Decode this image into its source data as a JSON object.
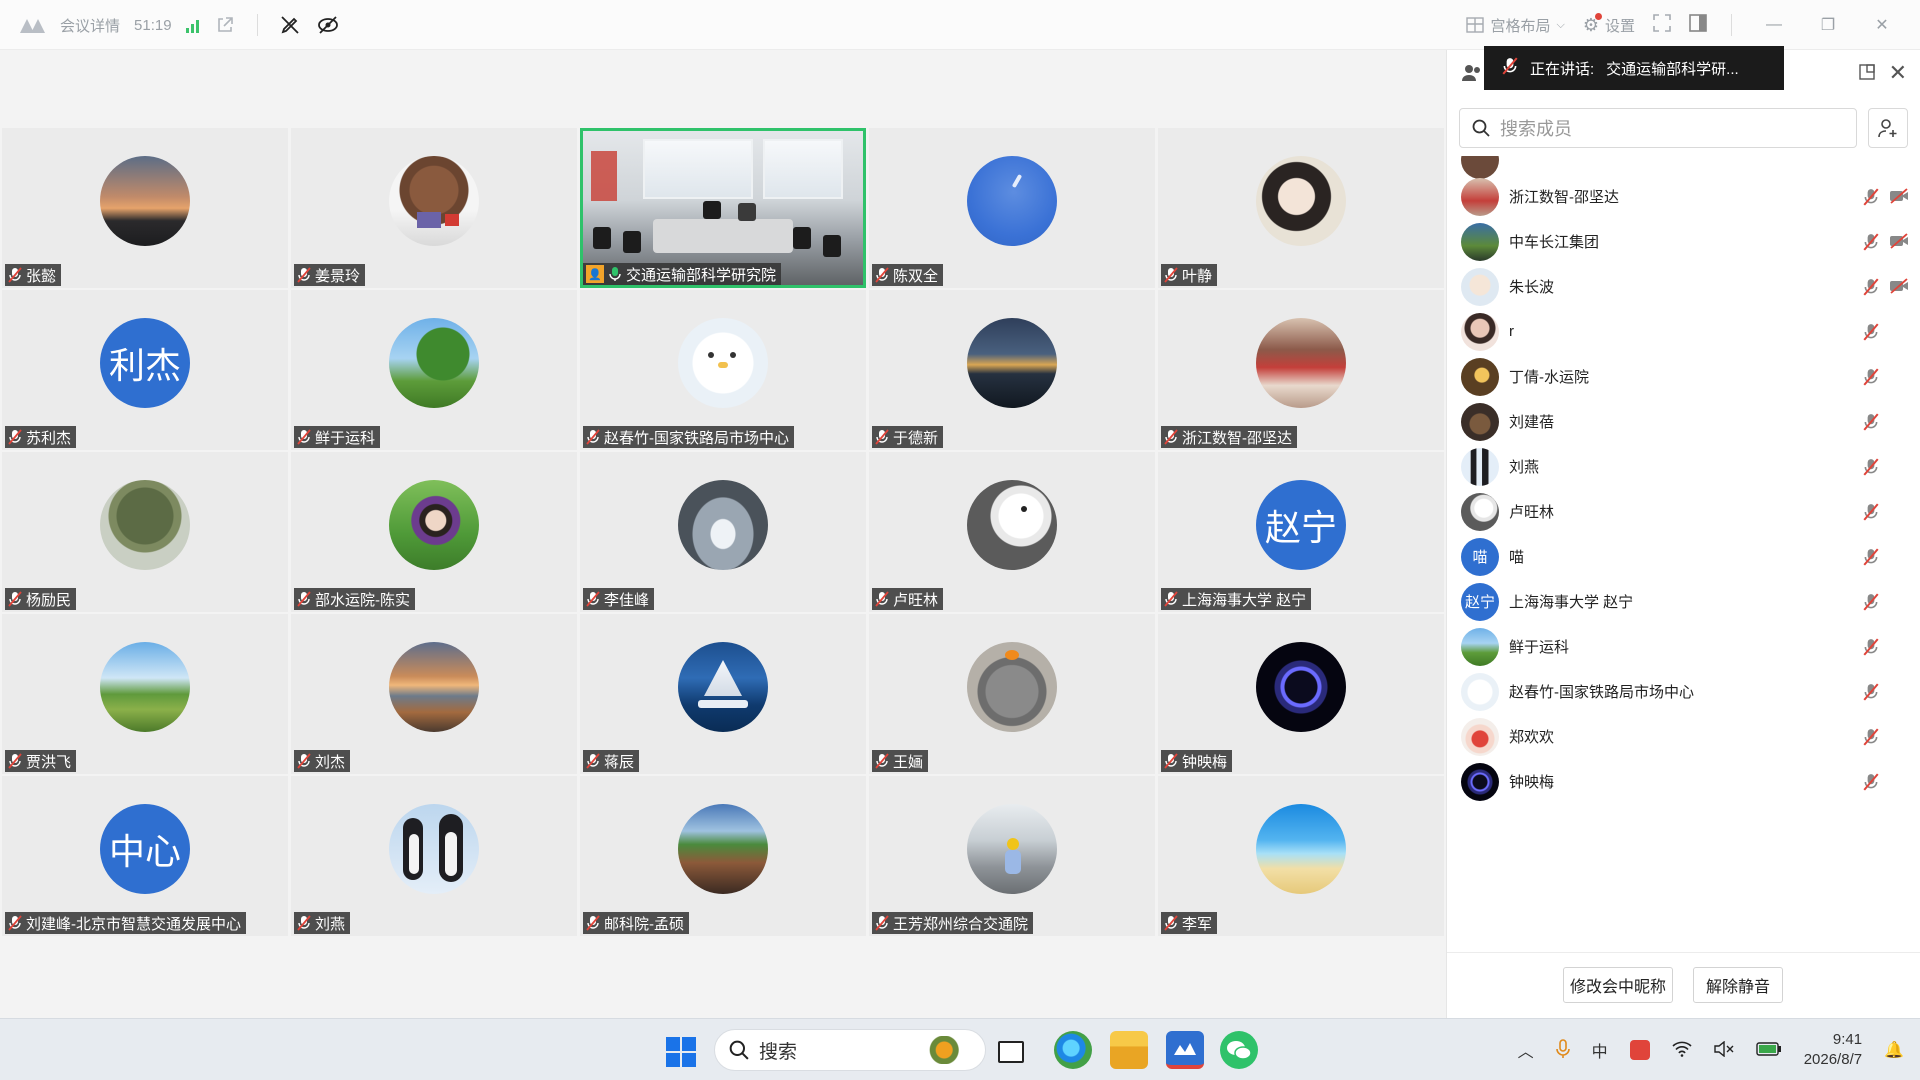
{
  "titlebar": {
    "meeting_details": "会议详情",
    "timer": "51:19",
    "layout_label": "宫格布局",
    "settings_label": "设置"
  },
  "tiles": [
    {
      "name": "张懿",
      "avatar": "sunset-photo"
    },
    {
      "name": "姜景玲",
      "avatar": "bear-photo"
    },
    {
      "name": "交通运输部科学研究院",
      "avatar": "meeting-room-video",
      "active": true
    },
    {
      "name": "陈双全",
      "avatar": "blue-sky-moon"
    },
    {
      "name": "叶静",
      "avatar": "woman-portrait"
    },
    {
      "name": "苏利杰",
      "avatar_text": "利杰"
    },
    {
      "name": "鲜于运科",
      "avatar": "tree-photo"
    },
    {
      "name": "赵春竹-国家铁路局市场中心",
      "avatar": "cartoon-bird"
    },
    {
      "name": "于德新",
      "avatar": "city-night"
    },
    {
      "name": "浙江数智-邵坚达",
      "avatar": "old-poster"
    },
    {
      "name": "杨励民",
      "avatar": "big-tree"
    },
    {
      "name": "部水运院-陈实",
      "avatar": "woman-garden"
    },
    {
      "name": "李佳峰",
      "avatar": "silver-abstract"
    },
    {
      "name": "卢旺林",
      "avatar": "bear-book"
    },
    {
      "name": "上海海事大学 赵宁",
      "avatar_text": "赵宁"
    },
    {
      "name": "贾洪飞",
      "avatar": "green-hills"
    },
    {
      "name": "刘杰",
      "avatar": "seaside-sunset"
    },
    {
      "name": "蒋辰",
      "avatar": "sailing-ship"
    },
    {
      "name": "王婳",
      "avatar": "gray-cat"
    },
    {
      "name": "钟映梅",
      "avatar": "dark-ring"
    },
    {
      "name": "刘建峰-北京市智慧交通发展中心",
      "avatar_text": "中心"
    },
    {
      "name": "刘燕",
      "avatar": "penguins"
    },
    {
      "name": "邮科院-孟硕",
      "avatar": "street-scene"
    },
    {
      "name": "王芳郑州综合交通院",
      "avatar": "child-photo"
    },
    {
      "name": "李军",
      "avatar": "beach-cartoon"
    }
  ],
  "sidebar": {
    "speaking_label": "正在讲话:",
    "speaking_name": "交通运输部科学研...",
    "search_placeholder": "搜索成员",
    "members": [
      {
        "name": "浙江数智-邵坚达",
        "cam_off": true
      },
      {
        "name": "中车长江集团",
        "cam_off": true
      },
      {
        "name": "朱长波",
        "cam_off": true
      },
      {
        "name": "r"
      },
      {
        "name": "丁倩-水运院"
      },
      {
        "name": "刘建蓓"
      },
      {
        "name": "刘燕"
      },
      {
        "name": "卢旺林"
      },
      {
        "name": "喵",
        "avatar_text": "喵"
      },
      {
        "name": "上海海事大学 赵宁",
        "avatar_text": "赵宁"
      },
      {
        "name": "鲜于运科"
      },
      {
        "name": "赵春竹-国家铁路局市场中心"
      },
      {
        "name": "郑欢欢"
      },
      {
        "name": "钟映梅"
      }
    ],
    "rename_button": "修改会中昵称",
    "unmute_button": "解除静音"
  },
  "taskbar": {
    "search_label": "搜索",
    "time": "9:41",
    "date": "2026/8/7"
  },
  "colors": {
    "accent_blue": "#2f6fd0",
    "active_green": "#2fc26a",
    "mute_red": "#e0443a"
  }
}
